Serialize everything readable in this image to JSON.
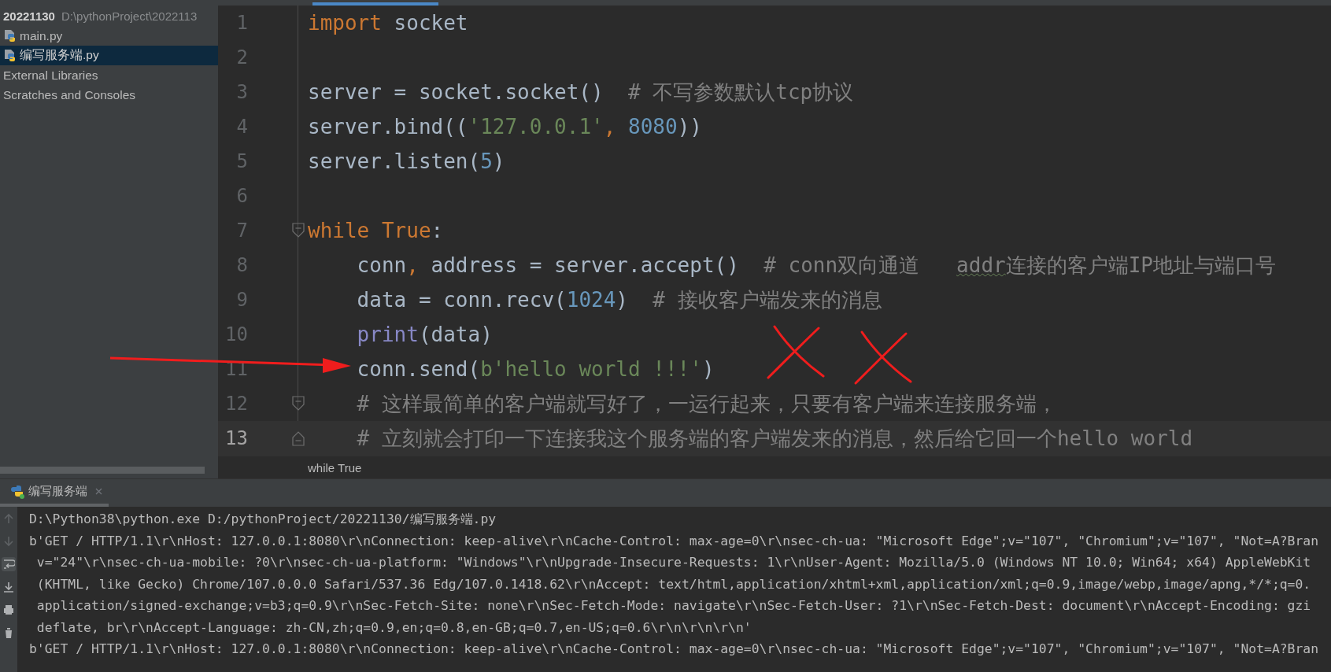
{
  "sidebar": {
    "project": {
      "name": "20221130",
      "path": "D:\\pythonProject\\2022113"
    },
    "items": [
      {
        "label": "main.py",
        "kind": "python-file",
        "selected": false
      },
      {
        "label": "编写服务端.py",
        "kind": "python-file",
        "selected": true
      },
      {
        "label": "External Libraries",
        "kind": "plain",
        "selected": false
      },
      {
        "label": "Scratches and Consoles",
        "kind": "plain",
        "selected": false
      }
    ]
  },
  "editor": {
    "lines": [
      {
        "number": "1",
        "tokens": [
          {
            "kind": "kw",
            "text": "import"
          },
          {
            "kind": "id",
            "text": " socket"
          }
        ]
      },
      {
        "number": "2"
      },
      {
        "number": "3",
        "tokens": [
          {
            "kind": "id",
            "text": "server = socket.socket()  "
          },
          {
            "kind": "cmt",
            "text": "# 不写参数默认tcp协议"
          }
        ]
      },
      {
        "number": "4",
        "tokens": [
          {
            "kind": "id",
            "text": "server.bind(("
          },
          {
            "kind": "str",
            "text": "'127.0.0.1'"
          },
          {
            "kind": "kw",
            "text": ", "
          },
          {
            "kind": "num",
            "text": "8080"
          },
          {
            "kind": "id",
            "text": "))"
          }
        ]
      },
      {
        "number": "5",
        "tokens": [
          {
            "kind": "id",
            "text": "server.listen("
          },
          {
            "kind": "num",
            "text": "5"
          },
          {
            "kind": "id",
            "text": ")"
          }
        ]
      },
      {
        "number": "6"
      },
      {
        "number": "7",
        "kind": "foldstart",
        "tokens": [
          {
            "kind": "kw",
            "text": "while True"
          },
          {
            "kind": "id",
            "text": ":"
          }
        ]
      },
      {
        "number": "8",
        "tokens": [
          {
            "kind": "id",
            "text": "    conn"
          },
          {
            "kind": "kw",
            "text": ", "
          },
          {
            "kind": "id",
            "text": "address = server.accept()  "
          },
          {
            "kind": "cmt",
            "text": "# conn双向通道   "
          },
          {
            "kind": "cmt",
            "text": "addr",
            "typo": true
          },
          {
            "kind": "cmt",
            "text": "连接的客户端IP地址与端口号"
          }
        ]
      },
      {
        "number": "9",
        "tokens": [
          {
            "kind": "id",
            "text": "    data = conn.recv("
          },
          {
            "kind": "num",
            "text": "1024"
          },
          {
            "kind": "id",
            "text": ")  "
          },
          {
            "kind": "cmt",
            "text": "# 接收客户端发来的消息"
          }
        ]
      },
      {
        "number": "10",
        "tokens": [
          {
            "kind": "builtin",
            "text": "    print"
          },
          {
            "kind": "id",
            "text": "(data)"
          }
        ]
      },
      {
        "number": "11",
        "tokens": [
          {
            "kind": "id",
            "text": "    conn.send("
          },
          {
            "kind": "str",
            "text": "b'hello world !!!'"
          },
          {
            "kind": "id",
            "text": ")"
          }
        ]
      },
      {
        "number": "12",
        "kind": "foldstart",
        "tokens": [
          {
            "kind": "cmt",
            "text": "    # 这样最简单的客户端就写好了，一运行起来，只要有客户端来连接服务端，"
          }
        ]
      },
      {
        "number": "13",
        "kind": "foldend",
        "current": true,
        "tokens": [
          {
            "kind": "cmt",
            "text": "    # 立刻就会打印一下连接我这个服务端的客户端发来的消息，然后给它回一个hello world"
          }
        ]
      }
    ],
    "breadcrumb": "while True"
  },
  "run_panel": {
    "tab": {
      "label": "编写服务端",
      "selected": true
    },
    "toolbar": [
      {
        "kind": "up",
        "selected": false
      },
      {
        "kind": "down",
        "selected": false
      },
      {
        "kind": "wrap",
        "selected": true
      },
      {
        "kind": "scrollend",
        "selected": false
      },
      {
        "kind": "print",
        "selected": false
      },
      {
        "kind": "delete",
        "selected": false
      }
    ],
    "output": [
      "D:\\Python38\\python.exe D:/pythonProject/20221130/编写服务端.py",
      "b'GET / HTTP/1.1\\r\\nHost: 127.0.0.1:8080\\r\\nConnection: keep-alive\\r\\nCache-Control: max-age=0\\r\\nsec-ch-ua: \"Microsoft Edge\";v=\"107\", \"Chromium\";v=\"107\", \"Not=A?Bran",
      " v=\"24\"\\r\\nsec-ch-ua-mobile: ?0\\r\\nsec-ch-ua-platform: \"Windows\"\\r\\nUpgrade-Insecure-Requests: 1\\r\\nUser-Agent: Mozilla/5.0 (Windows NT 10.0; Win64; x64) AppleWebKit",
      " (KHTML, like Gecko) Chrome/107.0.0.0 Safari/537.36 Edg/107.0.1418.62\\r\\nAccept: text/html,application/xhtml+xml,application/xml;q=0.9,image/webp,image/apng,*/*;q=0.",
      " application/signed-exchange;v=b3;q=0.9\\r\\nSec-Fetch-Site: none\\r\\nSec-Fetch-Mode: navigate\\r\\nSec-Fetch-User: ?1\\r\\nSec-Fetch-Dest: document\\r\\nAccept-Encoding: gzi",
      " deflate, br\\r\\nAccept-Language: zh-CN,zh;q=0.9,en;q=0.8,en-GB;q=0.7,en-US;q=0.6\\r\\n\\r\\n\\r\\n'",
      "b'GET / HTTP/1.1\\r\\nHost: 127.0.0.1:8080\\r\\nConnection: keep-alive\\r\\nCache-Control: max-age=0\\r\\nsec-ch-ua: \"Microsoft Edge\";v=\"107\", \"Chromium\";v=\"107\", \"Not=A?Bran"
    ]
  },
  "annotations": [
    {
      "kind": "arrow"
    },
    {
      "kind": "cross"
    },
    {
      "kind": "cross"
    }
  ]
}
